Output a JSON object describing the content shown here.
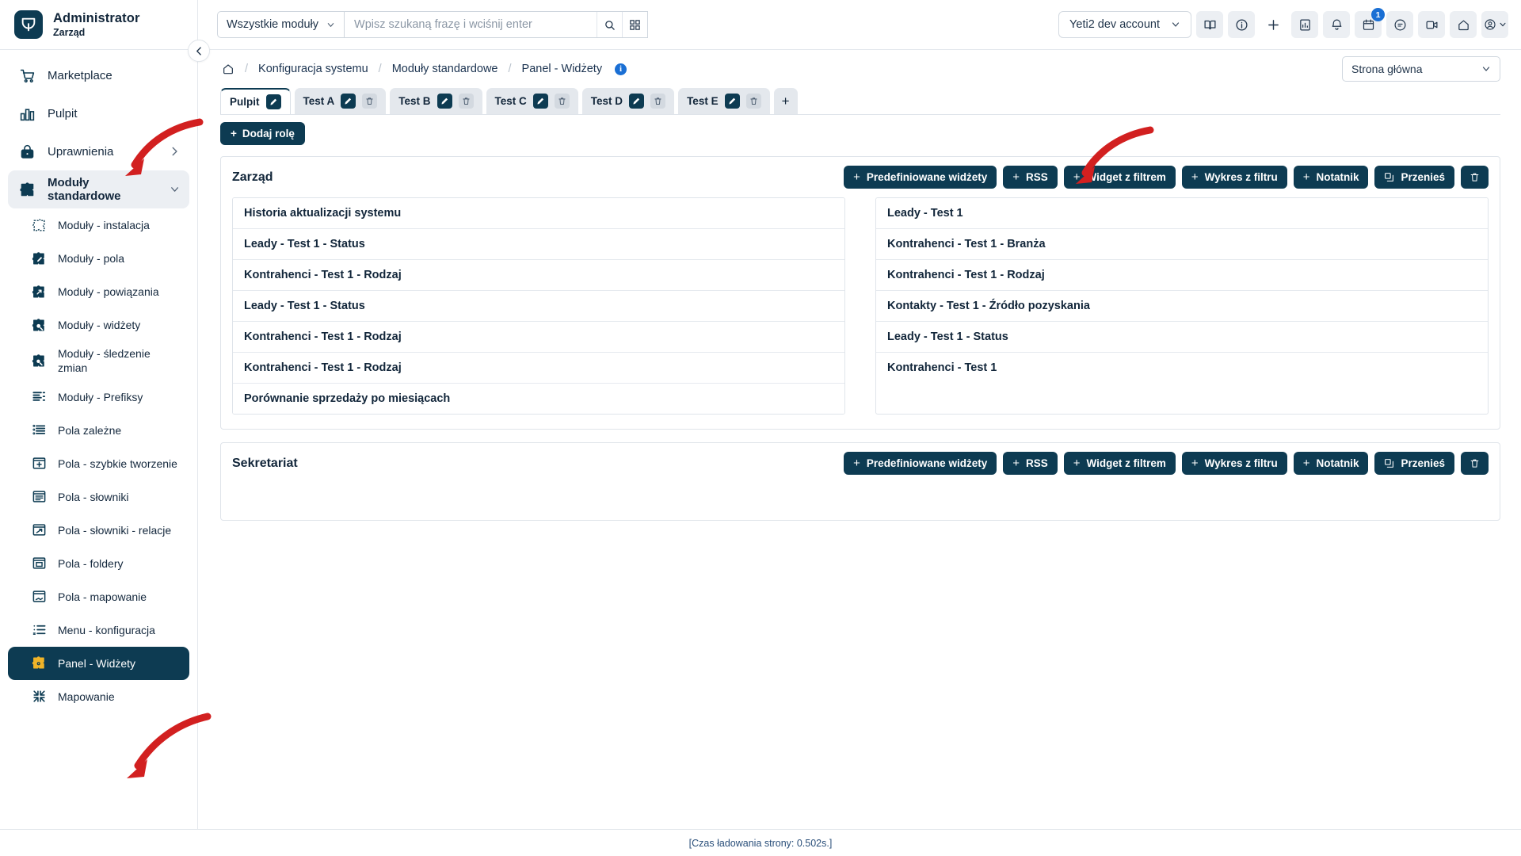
{
  "brand": {
    "title": "Administrator",
    "subtitle": "Zarząd",
    "logo_icon": "yeti-logo-icon"
  },
  "topbar": {
    "module_select": {
      "value": "Wszystkie moduły"
    },
    "search": {
      "placeholder": "Wpisz szukaną frazę i wciśnij enter",
      "value": ""
    },
    "account_select": {
      "value": "Yeti2 dev account"
    },
    "notification_count": "1",
    "icons": [
      "book-icon",
      "info-icon",
      "plus-icon",
      "reports-icon",
      "bell-icon",
      "calendar-icon",
      "chat-icon",
      "video-icon",
      "home-icon",
      "account-icon"
    ]
  },
  "sidebar": {
    "items": [
      {
        "label": "Marketplace",
        "icon": "cart-icon",
        "level": "top",
        "state": "normal"
      },
      {
        "label": "Pulpit",
        "icon": "dashboard-icon",
        "level": "top",
        "state": "normal"
      },
      {
        "label": "Uprawnienia",
        "icon": "lock-icon",
        "level": "top",
        "state": "normal",
        "chevron": "right"
      },
      {
        "label": "Moduły standardowe",
        "icon": "puzzle-icon",
        "level": "top",
        "state": "highlight",
        "chevron": "down"
      },
      {
        "label": "Moduły - instalacja",
        "icon": "puzzle-dashed-icon",
        "level": "sub",
        "state": "normal"
      },
      {
        "label": "Moduły - pola",
        "icon": "puzzle-pencil-icon",
        "level": "sub",
        "state": "normal"
      },
      {
        "label": "Moduły - powiązania",
        "icon": "puzzle-link-icon",
        "level": "sub",
        "state": "normal"
      },
      {
        "label": "Moduły - widżety",
        "icon": "puzzle-widget-icon",
        "level": "sub",
        "state": "normal"
      },
      {
        "label": "Moduły - śledzenie zmian",
        "icon": "puzzle-search-icon",
        "level": "sub",
        "state": "normal"
      },
      {
        "label": "Moduły - Prefiksy",
        "icon": "list-prefix-icon",
        "level": "sub",
        "state": "normal"
      },
      {
        "label": "Pola zależne",
        "icon": "list-dependent-icon",
        "level": "sub",
        "state": "normal"
      },
      {
        "label": "Pola - szybkie tworzenie",
        "icon": "window-plus-icon",
        "level": "sub",
        "state": "normal"
      },
      {
        "label": "Pola - słowniki",
        "icon": "window-list-icon",
        "level": "sub",
        "state": "normal"
      },
      {
        "label": "Pola - słowniki - relacje",
        "icon": "window-relation-icon",
        "level": "sub",
        "state": "normal"
      },
      {
        "label": "Pola - foldery",
        "icon": "window-folder-icon",
        "level": "sub",
        "state": "normal"
      },
      {
        "label": "Pola - mapowanie",
        "icon": "window-map-icon",
        "level": "sub",
        "state": "normal"
      },
      {
        "label": "Menu - konfiguracja",
        "icon": "menu-list-icon",
        "level": "sub",
        "state": "normal"
      },
      {
        "label": "Panel - Widżety",
        "icon": "puzzle-gear-icon",
        "level": "sub",
        "state": "active"
      },
      {
        "label": "Mapowanie",
        "icon": "collapse-arrows-icon",
        "level": "sub",
        "state": "normal"
      }
    ]
  },
  "breadcrumb": {
    "home_icon": "home-icon",
    "items": [
      "Konfiguracja systemu",
      "Moduły standardowe",
      "Panel - Widżety"
    ],
    "info_badge": "i"
  },
  "page_select": {
    "value": "Strona główna"
  },
  "tabs": {
    "items": [
      {
        "label": "Pulpit",
        "active": true,
        "has_delete": false
      },
      {
        "label": "Test A",
        "active": false,
        "has_delete": true
      },
      {
        "label": "Test B",
        "active": false,
        "has_delete": true
      },
      {
        "label": "Test C",
        "active": false,
        "has_delete": true
      },
      {
        "label": "Test D",
        "active": false,
        "has_delete": true
      },
      {
        "label": "Test E",
        "active": false,
        "has_delete": true
      }
    ],
    "add_label": "+"
  },
  "add_role_button": {
    "label": "Dodaj rolę",
    "prefix": "+"
  },
  "panel_actions": {
    "predefined": "Predefiniowane widżety",
    "rss": "RSS",
    "filter_widget": "Widget z filtrem",
    "filter_chart": "Wykres z filtru",
    "notebook": "Notatnik",
    "move": "Przenieś",
    "delete_icon": "trash-icon"
  },
  "panels": [
    {
      "title": "Zarząd",
      "left_widgets": [
        "Historia aktualizacji systemu",
        "Leady - Test 1 - Status",
        "Kontrahenci - Test 1 - Rodzaj",
        "Leady - Test 1 - Status",
        "Kontrahenci - Test 1 - Rodzaj",
        "Kontrahenci - Test 1 - Rodzaj",
        "Porównanie sprzedaży po miesiącach"
      ],
      "right_widgets": [
        "Leady - Test 1",
        "Kontrahenci - Test 1 - Branża",
        "Kontrahenci - Test 1 - Rodzaj",
        "Kontakty - Test 1 - Źródło pozyskania",
        "Leady - Test 1 - Status",
        "Kontrahenci - Test 1"
      ]
    },
    {
      "title": "Sekretariat",
      "left_widgets": [],
      "right_widgets": []
    }
  ],
  "footer": {
    "text": "[Czas ładowania strony: 0.502s.]"
  },
  "colors": {
    "navy": "#0d3b52",
    "accent_blue": "#1a6fd4",
    "arrow_red": "#d22020",
    "gold": "#f0b429"
  }
}
